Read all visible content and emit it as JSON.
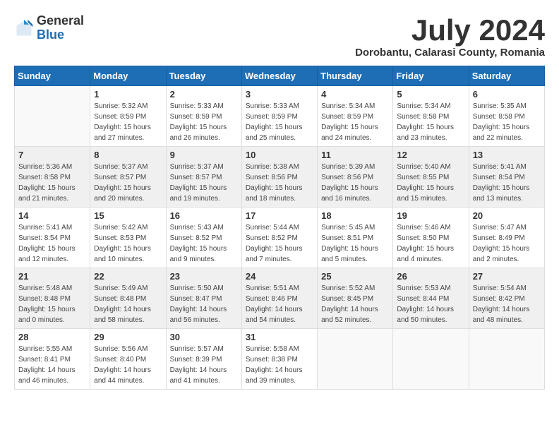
{
  "logo": {
    "general": "General",
    "blue": "Blue"
  },
  "title": "July 2024",
  "subtitle": "Dorobantu, Calarasi County, Romania",
  "days_of_week": [
    "Sunday",
    "Monday",
    "Tuesday",
    "Wednesday",
    "Thursday",
    "Friday",
    "Saturday"
  ],
  "weeks": [
    [
      {
        "day": "",
        "info": ""
      },
      {
        "day": "1",
        "info": "Sunrise: 5:32 AM\nSunset: 8:59 PM\nDaylight: 15 hours\nand 27 minutes."
      },
      {
        "day": "2",
        "info": "Sunrise: 5:33 AM\nSunset: 8:59 PM\nDaylight: 15 hours\nand 26 minutes."
      },
      {
        "day": "3",
        "info": "Sunrise: 5:33 AM\nSunset: 8:59 PM\nDaylight: 15 hours\nand 25 minutes."
      },
      {
        "day": "4",
        "info": "Sunrise: 5:34 AM\nSunset: 8:59 PM\nDaylight: 15 hours\nand 24 minutes."
      },
      {
        "day": "5",
        "info": "Sunrise: 5:34 AM\nSunset: 8:58 PM\nDaylight: 15 hours\nand 23 minutes."
      },
      {
        "day": "6",
        "info": "Sunrise: 5:35 AM\nSunset: 8:58 PM\nDaylight: 15 hours\nand 22 minutes."
      }
    ],
    [
      {
        "day": "7",
        "info": "Sunrise: 5:36 AM\nSunset: 8:58 PM\nDaylight: 15 hours\nand 21 minutes."
      },
      {
        "day": "8",
        "info": "Sunrise: 5:37 AM\nSunset: 8:57 PM\nDaylight: 15 hours\nand 20 minutes."
      },
      {
        "day": "9",
        "info": "Sunrise: 5:37 AM\nSunset: 8:57 PM\nDaylight: 15 hours\nand 19 minutes."
      },
      {
        "day": "10",
        "info": "Sunrise: 5:38 AM\nSunset: 8:56 PM\nDaylight: 15 hours\nand 18 minutes."
      },
      {
        "day": "11",
        "info": "Sunrise: 5:39 AM\nSunset: 8:56 PM\nDaylight: 15 hours\nand 16 minutes."
      },
      {
        "day": "12",
        "info": "Sunrise: 5:40 AM\nSunset: 8:55 PM\nDaylight: 15 hours\nand 15 minutes."
      },
      {
        "day": "13",
        "info": "Sunrise: 5:41 AM\nSunset: 8:54 PM\nDaylight: 15 hours\nand 13 minutes."
      }
    ],
    [
      {
        "day": "14",
        "info": "Sunrise: 5:41 AM\nSunset: 8:54 PM\nDaylight: 15 hours\nand 12 minutes."
      },
      {
        "day": "15",
        "info": "Sunrise: 5:42 AM\nSunset: 8:53 PM\nDaylight: 15 hours\nand 10 minutes."
      },
      {
        "day": "16",
        "info": "Sunrise: 5:43 AM\nSunset: 8:52 PM\nDaylight: 15 hours\nand 9 minutes."
      },
      {
        "day": "17",
        "info": "Sunrise: 5:44 AM\nSunset: 8:52 PM\nDaylight: 15 hours\nand 7 minutes."
      },
      {
        "day": "18",
        "info": "Sunrise: 5:45 AM\nSunset: 8:51 PM\nDaylight: 15 hours\nand 5 minutes."
      },
      {
        "day": "19",
        "info": "Sunrise: 5:46 AM\nSunset: 8:50 PM\nDaylight: 15 hours\nand 4 minutes."
      },
      {
        "day": "20",
        "info": "Sunrise: 5:47 AM\nSunset: 8:49 PM\nDaylight: 15 hours\nand 2 minutes."
      }
    ],
    [
      {
        "day": "21",
        "info": "Sunrise: 5:48 AM\nSunset: 8:48 PM\nDaylight: 15 hours\nand 0 minutes."
      },
      {
        "day": "22",
        "info": "Sunrise: 5:49 AM\nSunset: 8:48 PM\nDaylight: 14 hours\nand 58 minutes."
      },
      {
        "day": "23",
        "info": "Sunrise: 5:50 AM\nSunset: 8:47 PM\nDaylight: 14 hours\nand 56 minutes."
      },
      {
        "day": "24",
        "info": "Sunrise: 5:51 AM\nSunset: 8:46 PM\nDaylight: 14 hours\nand 54 minutes."
      },
      {
        "day": "25",
        "info": "Sunrise: 5:52 AM\nSunset: 8:45 PM\nDaylight: 14 hours\nand 52 minutes."
      },
      {
        "day": "26",
        "info": "Sunrise: 5:53 AM\nSunset: 8:44 PM\nDaylight: 14 hours\nand 50 minutes."
      },
      {
        "day": "27",
        "info": "Sunrise: 5:54 AM\nSunset: 8:42 PM\nDaylight: 14 hours\nand 48 minutes."
      }
    ],
    [
      {
        "day": "28",
        "info": "Sunrise: 5:55 AM\nSunset: 8:41 PM\nDaylight: 14 hours\nand 46 minutes."
      },
      {
        "day": "29",
        "info": "Sunrise: 5:56 AM\nSunset: 8:40 PM\nDaylight: 14 hours\nand 44 minutes."
      },
      {
        "day": "30",
        "info": "Sunrise: 5:57 AM\nSunset: 8:39 PM\nDaylight: 14 hours\nand 41 minutes."
      },
      {
        "day": "31",
        "info": "Sunrise: 5:58 AM\nSunset: 8:38 PM\nDaylight: 14 hours\nand 39 minutes."
      },
      {
        "day": "",
        "info": ""
      },
      {
        "day": "",
        "info": ""
      },
      {
        "day": "",
        "info": ""
      }
    ]
  ]
}
